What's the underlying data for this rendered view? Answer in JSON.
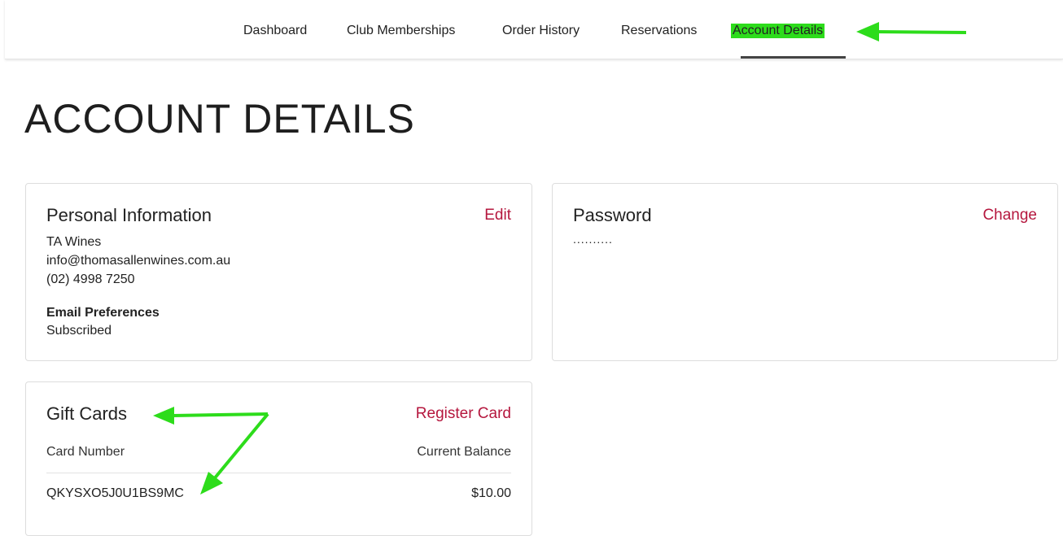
{
  "nav": {
    "items": [
      {
        "label": "Dashboard"
      },
      {
        "label": "Club Memberships"
      },
      {
        "label": "Order History"
      },
      {
        "label": "Reservations"
      },
      {
        "label": "Account Details"
      }
    ],
    "active": "Account Details",
    "highlight_color": "#2ddc1b"
  },
  "page": {
    "title": "ACCOUNT DETAILS"
  },
  "personal": {
    "title": "Personal Information",
    "action": "Edit",
    "name": "TA Wines",
    "email": "info@thomasallenwines.com.au",
    "phone": "(02) 4998 7250",
    "prefs_label": "Email Preferences",
    "prefs_value": "Subscribed"
  },
  "password": {
    "title": "Password",
    "action": "Change",
    "masked": ".........."
  },
  "giftcards": {
    "title": "Gift Cards",
    "action": "Register Card",
    "columns": [
      "Card Number",
      "Current Balance"
    ],
    "rows": [
      {
        "card_number": "QKYSXO5J0U1BS9MC",
        "balance": "$10.00"
      }
    ]
  },
  "colors": {
    "accent": "#b5173e",
    "annotation_arrow": "#2ddc1b"
  }
}
